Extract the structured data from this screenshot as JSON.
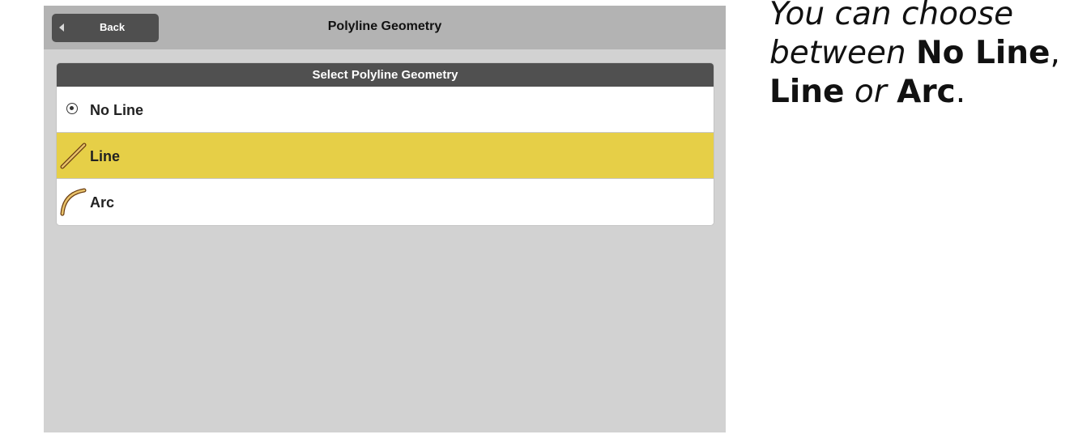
{
  "topbar": {
    "back_label": "Back",
    "title": "Polyline Geometry"
  },
  "panel": {
    "header": "Select Polyline Geometry",
    "selected": "Line",
    "options": [
      {
        "label": "No Line",
        "icon": "radio-dot-icon"
      },
      {
        "label": "Line",
        "icon": "line-segment-icon"
      },
      {
        "label": "Arc",
        "icon": "arc-segment-icon"
      }
    ]
  },
  "caption": {
    "part1": "You can choose between ",
    "opt1": "No Line",
    "comma": ",",
    "opt2": "Line",
    "or": " or ",
    "opt3": "Arc",
    "period": "."
  },
  "colors": {
    "screen_bg": "#d2d2d2",
    "topbar_bg": "#b3b3b3",
    "button_bg": "#4f4f4f",
    "panel_header_bg": "#505050",
    "selected_bg": "#e6cf47",
    "icon_fill": "#e8c26a",
    "icon_stroke": "#6b3e12"
  }
}
